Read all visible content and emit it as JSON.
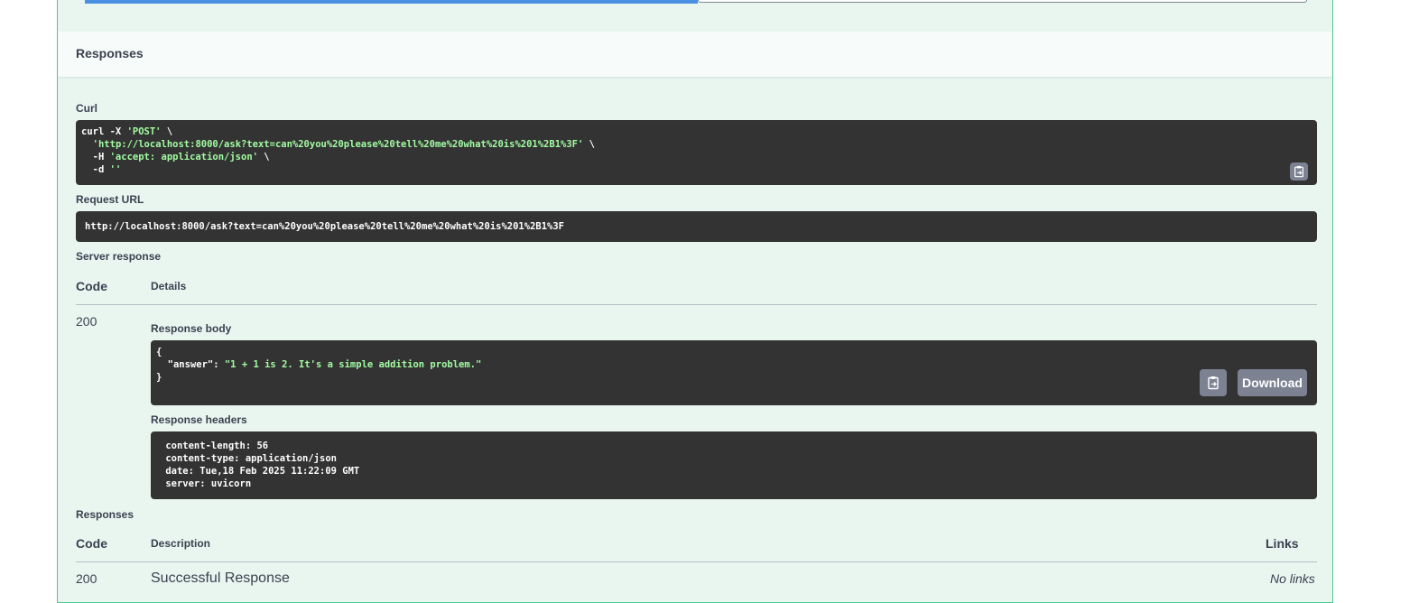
{
  "responses_header": "Responses",
  "curl": {
    "label": "Curl",
    "line1_prefix": "curl -X ",
    "line1_method": "'POST'",
    "line1_suffix": " \\",
    "line2_url": "'http://localhost:8000/ask?text=can%20you%20please%20tell%20me%20what%20is%201%2B1%3F'",
    "line2_suffix": " \\",
    "line3_prefix": "  -H ",
    "line3_header": "'accept: application/json'",
    "line3_suffix": " \\",
    "line4_prefix": "  -d ",
    "line4_data": "''"
  },
  "request_url": {
    "label": "Request URL",
    "value": "http://localhost:8000/ask?text=can%20you%20please%20tell%20me%20what%20is%201%2B1%3F"
  },
  "server_response": {
    "label": "Server response",
    "col_code": "Code",
    "col_details": "Details",
    "code": "200",
    "body_label": "Response body",
    "body_open": "{",
    "body_key": "  \"answer\": ",
    "body_value": "\"1 + 1 is 2. It's a simple addition problem.\"",
    "body_close": "}",
    "download_label": "Download",
    "headers_label": "Response headers",
    "headers": [
      " content-length: 56 ",
      " content-type: application/json ",
      " date: Tue,18 Feb 2025 11:22:09 GMT ",
      " server: uvicorn "
    ]
  },
  "responses": {
    "label": "Responses",
    "col_code": "Code",
    "col_description": "Description",
    "col_links": "Links",
    "rows": [
      {
        "code": "200",
        "description": "Successful Response",
        "links": "No links"
      }
    ]
  },
  "icons": {
    "copy": "clipboard-copy-icon"
  },
  "colors": {
    "accent": "#49cc90",
    "code_bg": "#333333",
    "string": "#a2fca2",
    "execute_blue": "#4990e2"
  }
}
